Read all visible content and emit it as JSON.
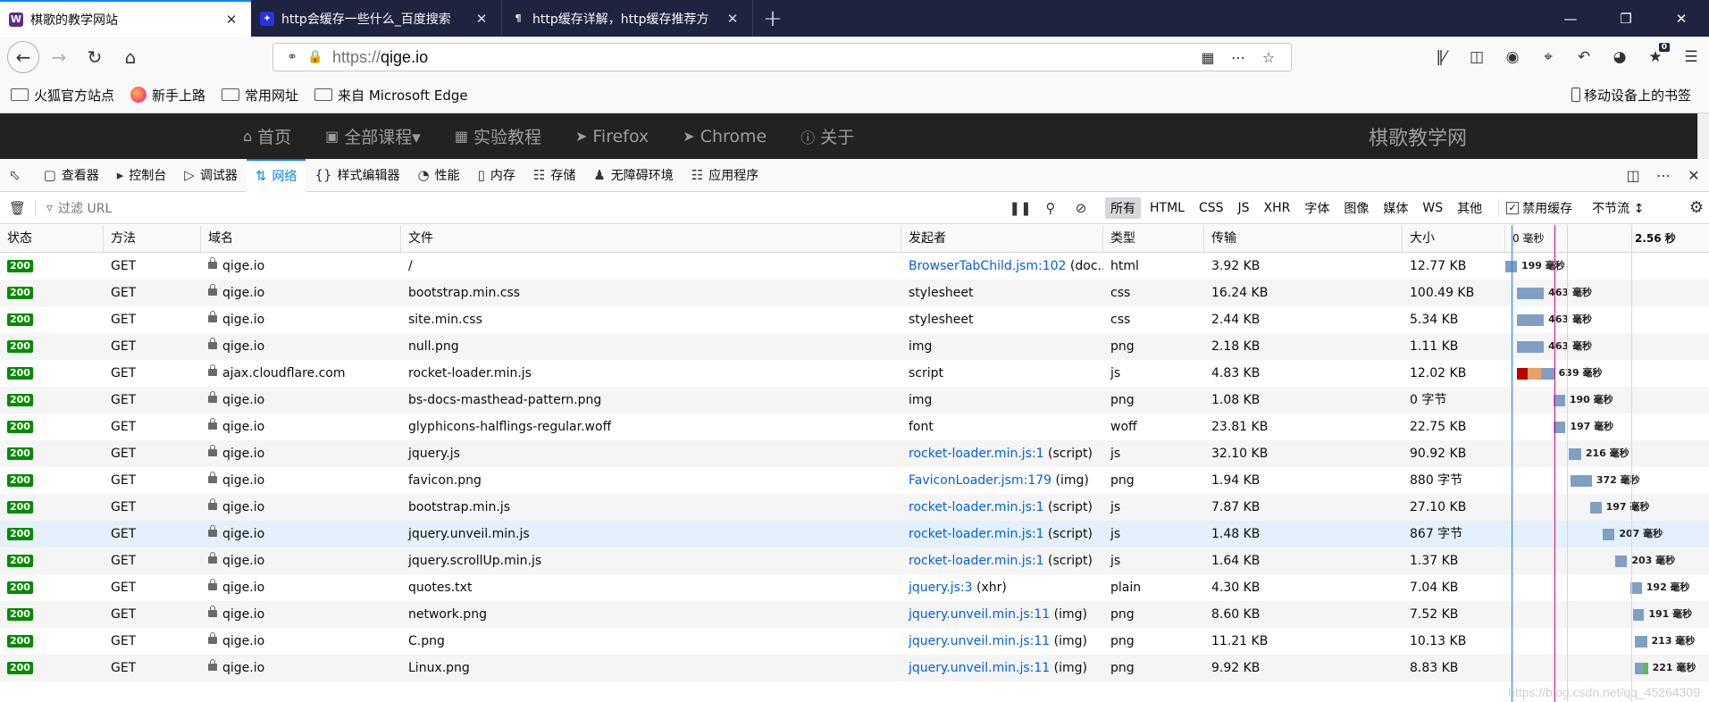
{
  "browser": {
    "tabs": [
      {
        "title": "棋歌的教学网站",
        "fav": "W",
        "fav_color": "#5b2c83",
        "active": true
      },
      {
        "title": "http会缓存一些什么_百度搜索",
        "fav": "✦",
        "fav_color": "#2932e1",
        "active": false
      },
      {
        "title": "http缓存详解，http缓存推荐方",
        "fav": "¶",
        "fav_color": "#202340",
        "active": false
      }
    ],
    "url_scheme": "https://",
    "url_host": "qige.io",
    "bookmarks": [
      "火狐官方站点",
      "新手上路",
      "常用网址",
      "来自 Microsoft Edge"
    ],
    "mobile_bookmarks": "移动设备上的书签",
    "library_badge": "0"
  },
  "site": {
    "nav": [
      {
        "icon": "⌂",
        "label": "首页"
      },
      {
        "icon": "▣",
        "label": "全部课程▾"
      },
      {
        "icon": "▦",
        "label": "实验教程"
      },
      {
        "icon": "➤",
        "label": "Firefox"
      },
      {
        "icon": "➤",
        "label": "Chrome"
      },
      {
        "icon": "ⓘ",
        "label": "关于"
      }
    ],
    "brand": "棋歌教学网"
  },
  "devtools": {
    "tabs": [
      {
        "icon": "▢",
        "label": "查看器"
      },
      {
        "icon": "▸",
        "label": "控制台"
      },
      {
        "icon": "▷",
        "label": "调试器"
      },
      {
        "icon": "⇅",
        "label": "网络",
        "selected": true
      },
      {
        "icon": "{}",
        "label": "样式编辑器"
      },
      {
        "icon": "◔",
        "label": "性能"
      },
      {
        "icon": "▯",
        "label": "内存"
      },
      {
        "icon": "☷",
        "label": "存储"
      },
      {
        "icon": "♟",
        "label": "无障碍环境"
      },
      {
        "icon": "☷",
        "label": "应用程序"
      }
    ],
    "filter_placeholder": "过滤 URL",
    "type_filters": [
      "所有",
      "HTML",
      "CSS",
      "JS",
      "XHR",
      "字体",
      "图像",
      "媒体",
      "WS",
      "其他"
    ],
    "disable_cache": "禁用缓存",
    "throttle": "不节流 ↕",
    "columns": [
      "状态",
      "方法",
      "域名",
      "文件",
      "发起者",
      "类型",
      "传输",
      "大小"
    ],
    "timeline_start": "0 毫秒",
    "timeline_end": "2.56 秒"
  },
  "requests": [
    {
      "status": "200",
      "method": "GET",
      "domain": "qige.io",
      "file": "/",
      "initiator_link": "BrowserTabChild.jsm:102",
      "initiator_rest": " (doc...",
      "type": "html",
      "transferred": "3.92 KB",
      "size": "12.77 KB",
      "time_label": "199 毫秒",
      "wf_start": 0,
      "wf_dur": 199
    },
    {
      "status": "200",
      "method": "GET",
      "domain": "qige.io",
      "file": "bootstrap.min.css",
      "initiator_link": "",
      "initiator_rest": "stylesheet",
      "type": "css",
      "transferred": "16.24 KB",
      "size": "100.49 KB",
      "time_label": "463 毫秒",
      "wf_start": 199,
      "wf_dur": 463
    },
    {
      "status": "200",
      "method": "GET",
      "domain": "qige.io",
      "file": "site.min.css",
      "initiator_link": "",
      "initiator_rest": "stylesheet",
      "type": "css",
      "transferred": "2.44 KB",
      "size": "5.34 KB",
      "time_label": "463 毫秒",
      "wf_start": 199,
      "wf_dur": 463
    },
    {
      "status": "200",
      "method": "GET",
      "domain": "qige.io",
      "file": "null.png",
      "initiator_link": "",
      "initiator_rest": "img",
      "type": "png",
      "transferred": "2.18 KB",
      "size": "1.11 KB",
      "time_label": "463 毫秒",
      "wf_start": 199,
      "wf_dur": 463
    },
    {
      "status": "200",
      "method": "GET",
      "domain": "ajax.cloudflare.com",
      "file": "rocket-loader.min.js",
      "initiator_link": "",
      "initiator_rest": "script",
      "type": "js",
      "transferred": "4.83 KB",
      "size": "12.02 KB",
      "time_label": "639 毫秒",
      "wf_start": 199,
      "wf_dur": 639,
      "multi": true
    },
    {
      "status": "200",
      "method": "GET",
      "domain": "qige.io",
      "file": "bs-docs-masthead-pattern.png",
      "initiator_link": "",
      "initiator_rest": "img",
      "type": "png",
      "transferred": "1.08 KB",
      "size": "0 字节",
      "time_label": "190 毫秒",
      "wf_start": 835,
      "wf_dur": 190
    },
    {
      "status": "200",
      "method": "GET",
      "domain": "qige.io",
      "file": "glyphicons-halflings-regular.woff",
      "initiator_link": "",
      "initiator_rest": "font",
      "type": "woff",
      "transferred": "23.81 KB",
      "size": "22.75 KB",
      "time_label": "197 毫秒",
      "wf_start": 835,
      "wf_dur": 197
    },
    {
      "status": "200",
      "method": "GET",
      "domain": "qige.io",
      "file": "jquery.js",
      "initiator_link": "rocket-loader.min.js:1",
      "initiator_rest": " (script)",
      "type": "js",
      "transferred": "32.10 KB",
      "size": "90.92 KB",
      "time_label": "216 毫秒",
      "wf_start": 1085,
      "wf_dur": 216
    },
    {
      "status": "200",
      "method": "GET",
      "domain": "qige.io",
      "file": "favicon.png",
      "initiator_link": "FaviconLoader.jsm:179",
      "initiator_rest": " (img)",
      "type": "png",
      "transferred": "1.94 KB",
      "size": "880 字节",
      "time_label": "372 毫秒",
      "wf_start": 1113,
      "wf_dur": 372
    },
    {
      "status": "200",
      "method": "GET",
      "domain": "qige.io",
      "file": "bootstrap.min.js",
      "initiator_link": "rocket-loader.min.js:1",
      "initiator_rest": " (script)",
      "type": "js",
      "transferred": "7.87 KB",
      "size": "27.10 KB",
      "time_label": "197 毫秒",
      "wf_start": 1452,
      "wf_dur": 197
    },
    {
      "status": "200",
      "method": "GET",
      "domain": "qige.io",
      "file": "jquery.unveil.min.js",
      "initiator_link": "rocket-loader.min.js:1",
      "initiator_rest": " (script)",
      "type": "js",
      "transferred": "1.48 KB",
      "size": "867 字节",
      "time_label": "207 毫秒",
      "wf_start": 1669,
      "wf_dur": 207,
      "highlight": true
    },
    {
      "status": "200",
      "method": "GET",
      "domain": "qige.io",
      "file": "jquery.scrollUp.min.js",
      "initiator_link": "rocket-loader.min.js:1",
      "initiator_rest": " (script)",
      "type": "js",
      "transferred": "1.64 KB",
      "size": "1.37 KB",
      "time_label": "203 毫秒",
      "wf_start": 1887,
      "wf_dur": 203
    },
    {
      "status": "200",
      "method": "GET",
      "domain": "qige.io",
      "file": "quotes.txt",
      "initiator_link": "jquery.js:3",
      "initiator_rest": " (xhr)",
      "type": "plain",
      "transferred": "4.30 KB",
      "size": "7.04 KB",
      "time_label": "192 毫秒",
      "wf_start": 2150,
      "wf_dur": 192
    },
    {
      "status": "200",
      "method": "GET",
      "domain": "qige.io",
      "file": "network.png",
      "initiator_link": "jquery.unveil.min.js:11",
      "initiator_rest": " (img)",
      "type": "png",
      "transferred": "8.60 KB",
      "size": "7.52 KB",
      "time_label": "191 毫秒",
      "wf_start": 2191,
      "wf_dur": 191
    },
    {
      "status": "200",
      "method": "GET",
      "domain": "qige.io",
      "file": "C.png",
      "initiator_link": "jquery.unveil.min.js:11",
      "initiator_rest": " (img)",
      "type": "png",
      "transferred": "11.21 KB",
      "size": "10.13 KB",
      "time_label": "213 毫秒",
      "wf_start": 2217,
      "wf_dur": 213
    },
    {
      "status": "200",
      "method": "GET",
      "domain": "qige.io",
      "file": "Linux.png",
      "initiator_link": "jquery.unveil.min.js:11",
      "initiator_rest": " (img)",
      "type": "png",
      "transferred": "9.92 KB",
      "size": "8.83 KB",
      "time_label": "221 毫秒",
      "wf_start": 2225,
      "wf_dur": 221,
      "green": true
    }
  ],
  "watermark": "https://blog.csdn.net/qq_45264309",
  "colors": {
    "accent": "#0a84ff",
    "status_ok": "#058b00",
    "waterfall": "#7f9fc5",
    "dom_line": "#0a84ff",
    "load_line": "#e5007f"
  }
}
